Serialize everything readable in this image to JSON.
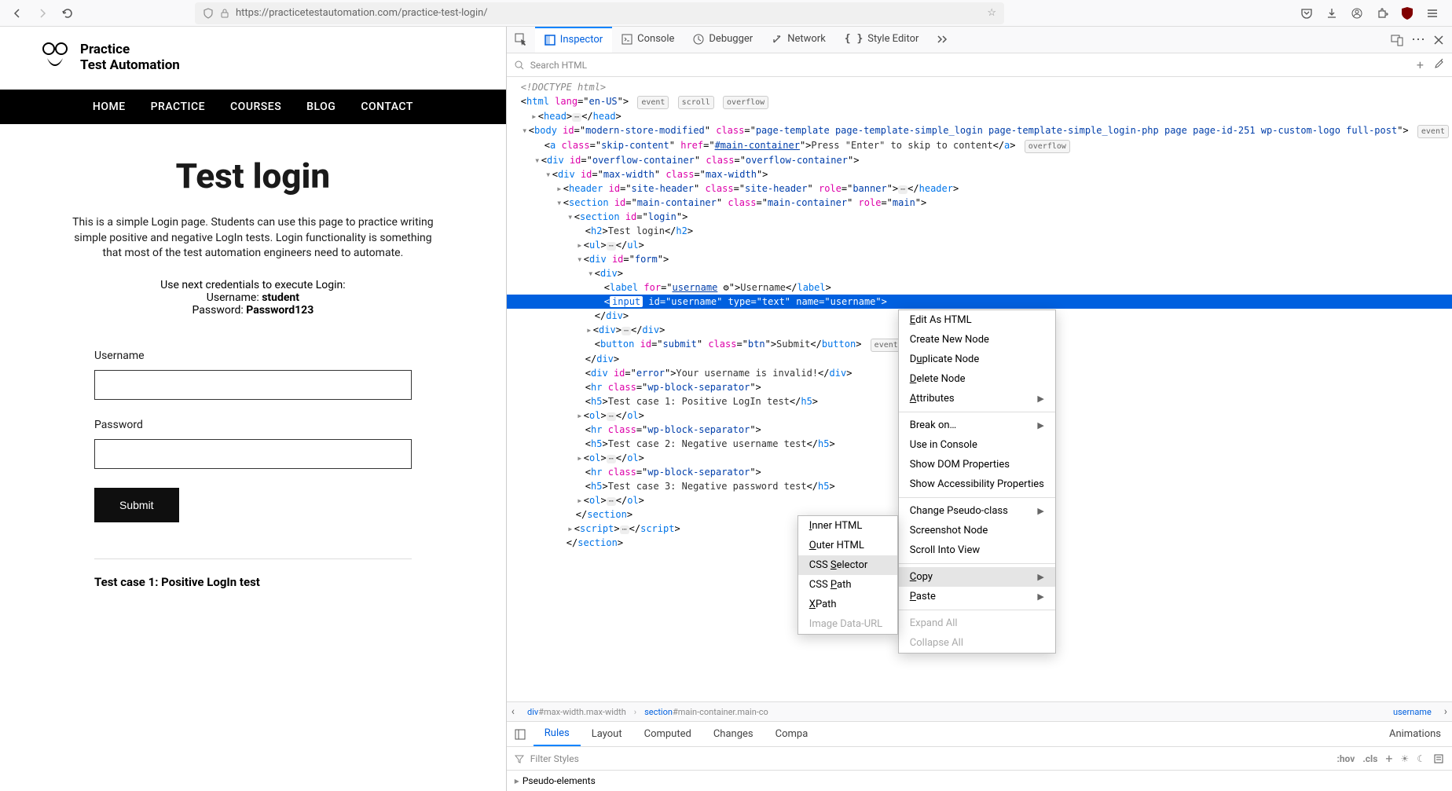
{
  "browser": {
    "url": "https://practicetestautomation.com/practice-test-login/"
  },
  "site": {
    "logo_line1": "Practice",
    "logo_line2": "Test Automation",
    "nav": [
      "HOME",
      "PRACTICE",
      "COURSES",
      "BLOG",
      "CONTACT"
    ]
  },
  "page": {
    "heading": "Test login",
    "desc": "This is a simple Login page. Students can use this page to practice writing simple positive and negative LogIn tests. Login functionality is something that most of the test automation engineers need to automate.",
    "creds_intro": "Use next credentials to execute Login:",
    "username_line_label": "Username: ",
    "username_line_value": "student",
    "password_line_label": "Password: ",
    "password_line_value": "Password123",
    "label_username": "Username",
    "label_password": "Password",
    "submit": "Submit",
    "tc1": "Test case 1: Positive LogIn test"
  },
  "devtools": {
    "tabs": {
      "inspector": "Inspector",
      "console": "Console",
      "debugger": "Debugger",
      "network": "Network",
      "style": "Style Editor"
    },
    "search_placeholder": "Search HTML",
    "bottom_tabs": [
      "Rules",
      "Layout",
      "Computed",
      "Changes",
      "Compa",
      "Animations"
    ],
    "filter_placeholder": "Filter Styles",
    "hov": ":hov",
    "cls": ".cls",
    "pseudo": "Pseudo-elements"
  },
  "tree": {
    "doctype": "<!DOCTYPE html>",
    "html_attrs": {
      "lang": "en-US"
    },
    "badges": {
      "event": "event",
      "scroll": "scroll",
      "overflow": "overflow"
    },
    "body_id": "modern-store-modified",
    "body_class": "page-template page-template-simple_login page-template-simple_login-php page page-id-251 wp-custom-logo full-post",
    "skip_text": "Press \"Enter\" to skip to content",
    "skip_href": "#main-container",
    "div1_id": "overflow-container",
    "div1_class": "overflow-container",
    "div2_id": "max-width",
    "div2_class": "max-width",
    "header_id": "site-header",
    "header_class": "site-header",
    "header_role": "banner",
    "section_main_id": "main-container",
    "section_main_class": "main-container",
    "section_main_role": "main",
    "section_login_id": "login",
    "h2_text": "Test login",
    "form_id": "form",
    "label_for": "username",
    "label_text": "Username",
    "input_id": "username",
    "input_type": "text",
    "input_name": "username",
    "button_id": "submit",
    "button_class": "btn",
    "button_text": "Submit",
    "error_id": "error",
    "error_text": "Your username is invalid!",
    "hr_class": "wp-block-separator",
    "h5_1": "Test case 1: Positive LogIn test",
    "h5_2": "Test case 2: Negative username test",
    "h5_3": "Test case 3: Negative password test"
  },
  "crumbs": {
    "c1_el": "div",
    "c1_rest": "#max-width.max-width",
    "c2_el": "section",
    "c2_rest": "#main-container.main-co",
    "c3_el": "username"
  },
  "ctx_main": {
    "edit_html": "Edit As HTML",
    "create_node": "Create New Node",
    "duplicate": "Duplicate Node",
    "delete": "Delete Node",
    "attributes": "Attributes",
    "break_on": "Break on…",
    "use_console": "Use in Console",
    "show_dom": "Show DOM Properties",
    "show_a11y": "Show Accessibility Properties",
    "change_pseudo": "Change Pseudo-class",
    "screenshot": "Screenshot Node",
    "scroll_into": "Scroll Into View",
    "copy": "Copy",
    "paste": "Paste",
    "expand": "Expand All",
    "collapse": "Collapse All"
  },
  "ctx_copy": {
    "inner": "Inner HTML",
    "outer": "Outer HTML",
    "css_sel": "CSS Selector",
    "css_path": "CSS Path",
    "xpath": "XPath",
    "image_data": "Image Data-URL"
  }
}
